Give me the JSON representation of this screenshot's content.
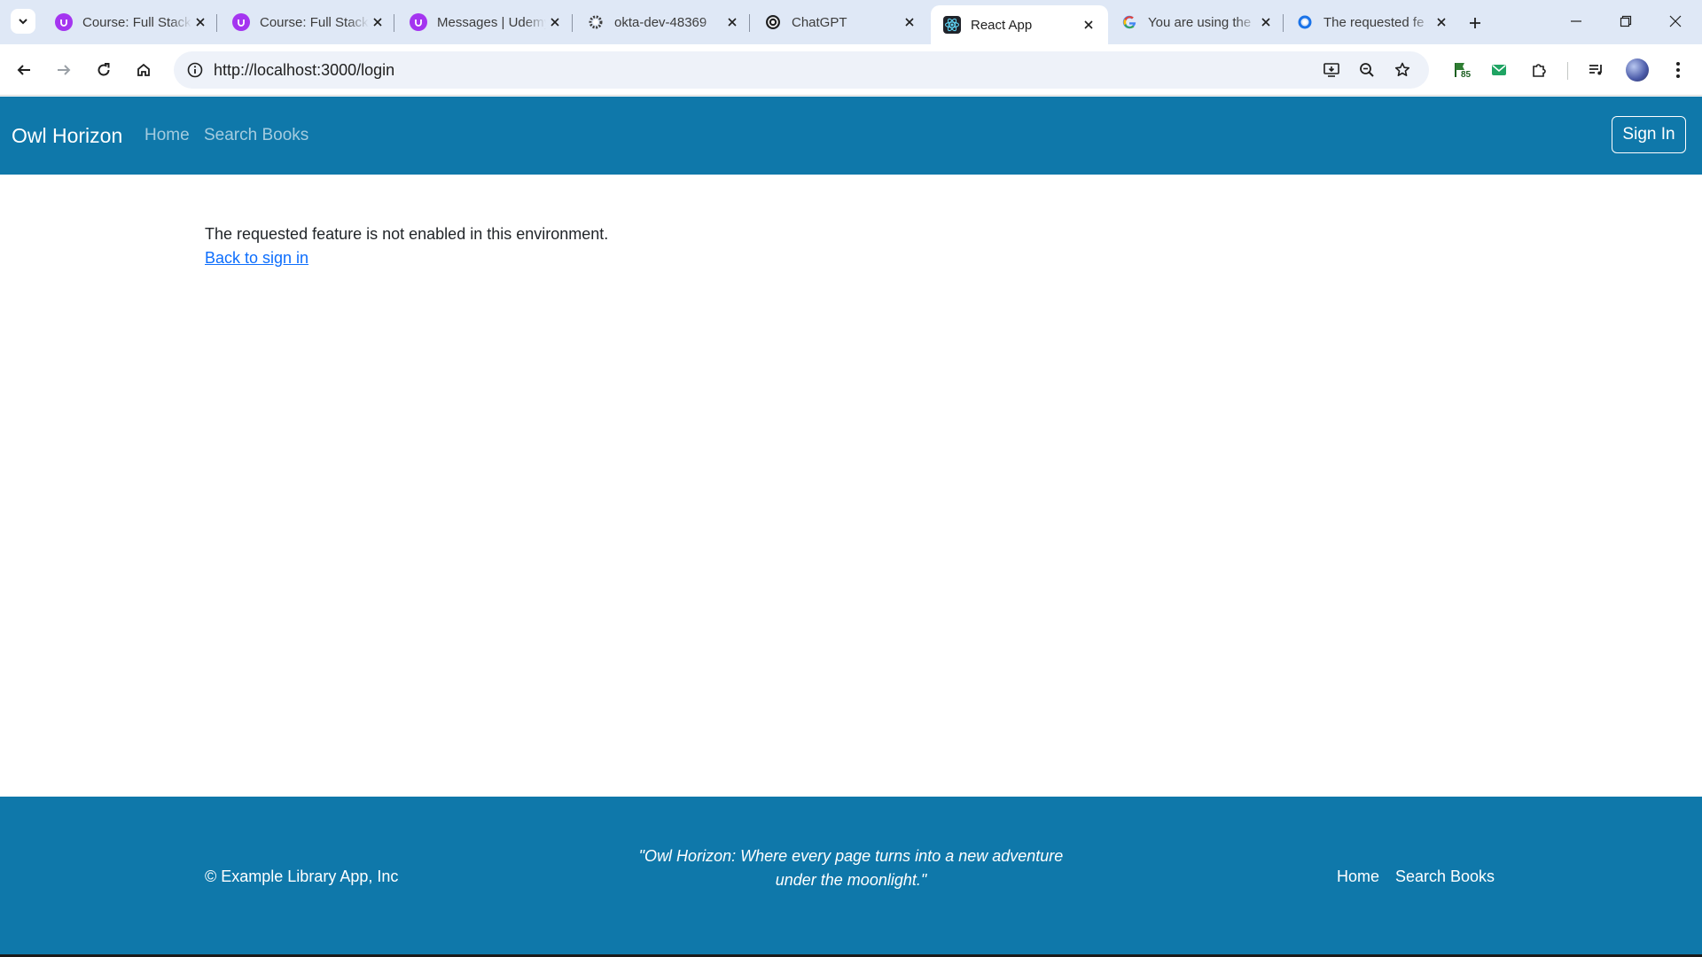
{
  "browser": {
    "tabs": [
      {
        "title": "Course: Full Stack",
        "favicon": "udemy-icon",
        "color": "#a435f0"
      },
      {
        "title": "Course: Full Stack",
        "favicon": "udemy-icon",
        "color": "#a435f0"
      },
      {
        "title": "Messages | Udemy",
        "favicon": "udemy-icon",
        "color": "#a435f0"
      },
      {
        "title": "okta-dev-48369",
        "favicon": "okta-icon",
        "color": "#3c3c3c"
      },
      {
        "title": "ChatGPT",
        "favicon": "chatgpt-icon",
        "color": "#202123"
      },
      {
        "title": "React App",
        "favicon": "react-icon",
        "color": "#61dafb",
        "active": true
      },
      {
        "title": "You are using the",
        "favicon": "google-icon",
        "color": "#4285f4"
      },
      {
        "title": "The requested fe",
        "favicon": "loading-icon",
        "color": "#1a73e8"
      }
    ],
    "url": "http://localhost:3000/login",
    "extension_badge": "85"
  },
  "navbar": {
    "brand": "Owl Horizon",
    "links": [
      "Home",
      "Search Books"
    ],
    "signin_label": "Sign In",
    "bg_color": "#0f78aa"
  },
  "main": {
    "message": "The requested feature is not enabled in this environment.",
    "back_link": "Back to sign in"
  },
  "footer": {
    "copyright": "© Example Library App, Inc",
    "quote_line1": "\"Owl Horizon: Where every page turns into a new adventure",
    "quote_line2": "under the moonlight.\"",
    "links": [
      "Home",
      "Search Books"
    ]
  }
}
